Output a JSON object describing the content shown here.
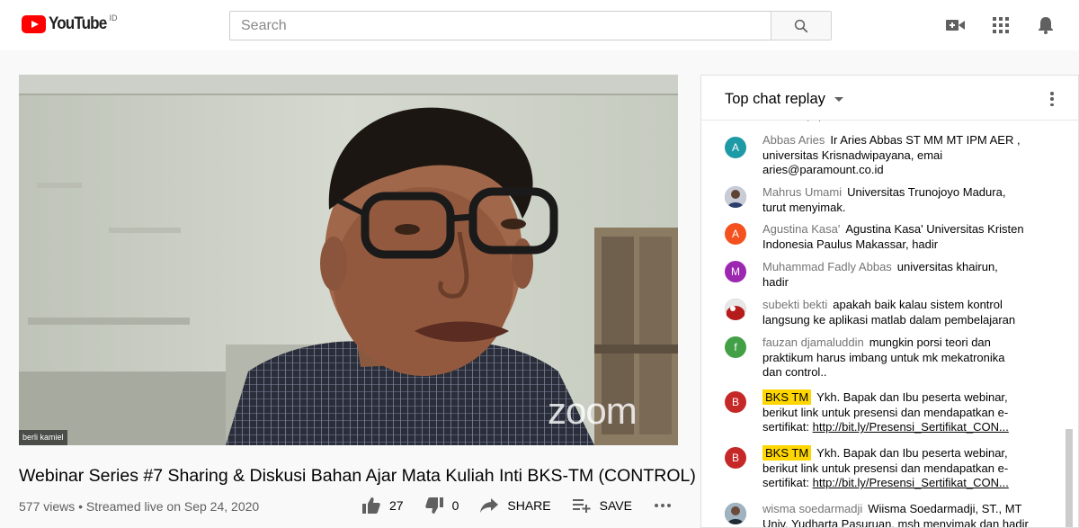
{
  "masthead": {
    "logo_text": "YouTube",
    "country_code": "ID",
    "search_placeholder": "Search",
    "icons": [
      "search-icon",
      "create-video-icon",
      "apps-grid-icon",
      "notifications-bell-icon"
    ]
  },
  "video": {
    "watermark": "zoom",
    "participant_name": "berli kamiel",
    "title": "Webinar Series #7 Sharing & Diskusi Bahan Ajar Mata Kuliah Inti BKS-TM (CONTROL)",
    "views_info": "577 views • Streamed live on Sep 24, 2020",
    "likes": "27",
    "dislikes": "0",
    "share_label": "SHARE",
    "save_label": "SAVE"
  },
  "chat": {
    "header_title": "Top chat replay",
    "partial_top": "di chat :-) q",
    "messages": [
      {
        "author": "Abbas Aries",
        "initial": "A",
        "avatar_color": "#1e9aa6",
        "line1": "Ir Aries Abbas ST MM MT IPM AER ,",
        "line2": "universitas Krisnadwipayana, emai",
        "line3": "aries@paramount.co.id"
      },
      {
        "author": "Mahrus Umami",
        "initial": "",
        "avatar_color": "#5a6e8a",
        "line1": "Universitas Trunojoyo Madura,",
        "line2": "turut menyimak."
      },
      {
        "author": "Agustina Kasa'",
        "initial": "A",
        "avatar_color": "#f4511e",
        "line1": "Agustina Kasa' Universitas Kristen",
        "line2": "Indonesia Paulus Makassar, hadir"
      },
      {
        "author": "Muhammad Fadly Abbas",
        "initial": "M",
        "avatar_color": "#9c27b0",
        "line1": "universitas khairun,",
        "line2": "hadir"
      },
      {
        "author": "subekti bekti",
        "initial": "",
        "avatar_color": "#8b3a3a",
        "line1": "apakah baik kalau sistem kontrol",
        "line2": "langsung ke aplikasi matlab dalam pembelajaran"
      },
      {
        "author": "fauzan djamaluddin",
        "initial": "f",
        "avatar_color": "#43a047",
        "line1": "mungkin porsi teori dan",
        "line2": "praktikum harus imbang untuk mk mekatronika",
        "line3": "dan control.."
      },
      {
        "author": "BKS TM",
        "initial": "B",
        "avatar_color": "#c62828",
        "line1": "Ykh. Bapak dan Ibu peserta webinar,",
        "line2": "berikut link untuk presensi dan mendapatkan e-",
        "line3_prefix": "sertifikat: ",
        "link": "http://bit.ly/Presensi_Sertifikat_CON..."
      },
      {
        "author": "BKS TM",
        "initial": "B",
        "avatar_color": "#c62828",
        "line1": "Ykh. Bapak dan Ibu peserta webinar,",
        "line2": "berikut link untuk presensi dan mendapatkan e-",
        "line3_prefix": "sertifikat: ",
        "link": "http://bit.ly/Presensi_Sertifikat_CON..."
      },
      {
        "author": "wisma soedarmadji",
        "initial": "",
        "avatar_color": "#455a64",
        "line1": "Wiisma Soedarmadji, ST., MT",
        "line2": "Univ. Yudharta Pasuruan, msh menyimak dan hadir"
      }
    ]
  }
}
